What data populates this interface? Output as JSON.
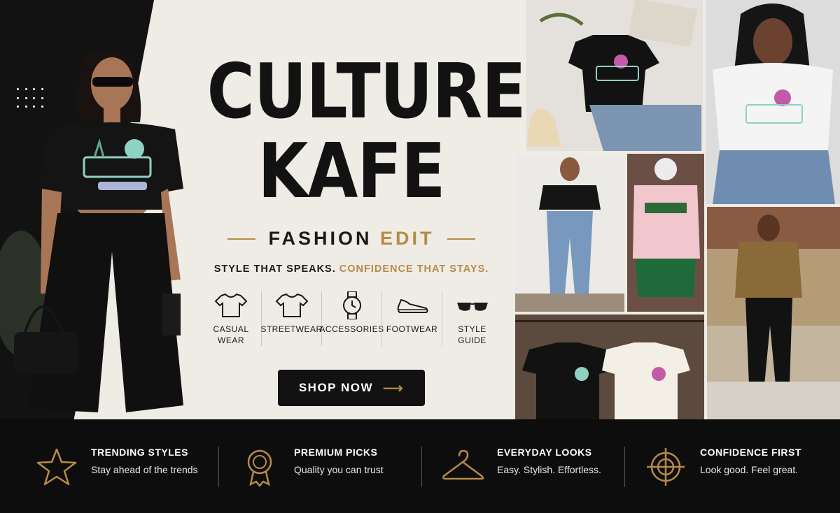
{
  "brand": {
    "line1": "CULTURE",
    "line2": "KAFE"
  },
  "fashion_edit": {
    "part1": "FASHION ",
    "part2": "EDIT"
  },
  "tagline": {
    "part1": "STYLE THAT SPEAKS. ",
    "part2": "CONFIDENCE THAT STAYS."
  },
  "categories": [
    {
      "label": "CASUAL WEAR",
      "icon": "tshirt-icon"
    },
    {
      "label": "STREETWEAR",
      "icon": "tshirt-icon"
    },
    {
      "label": "ACCESSORIES",
      "icon": "watch-icon"
    },
    {
      "label": "FOOTWEAR",
      "icon": "sneaker-icon"
    },
    {
      "label": "STYLE GUIDE",
      "icon": "sunglasses-icon"
    }
  ],
  "cta": {
    "label": "SHOP NOW",
    "arrow": "⟶"
  },
  "features": [
    {
      "title": "TRENDING STYLES",
      "desc": "Stay ahead of the trends",
      "icon": "star-icon"
    },
    {
      "title": "PREMIUM PICKS",
      "desc": "Quality you can trust",
      "icon": "award-icon"
    },
    {
      "title": "EVERYDAY LOOKS",
      "desc": "Easy. Stylish. Effortless.",
      "icon": "hanger-icon"
    },
    {
      "title": "CONFIDENCE FIRST",
      "desc": "Look good. Feel great.",
      "icon": "target-icon"
    }
  ],
  "colors": {
    "accent": "#b68a48",
    "dark": "#121212",
    "cream": "#efece6"
  }
}
